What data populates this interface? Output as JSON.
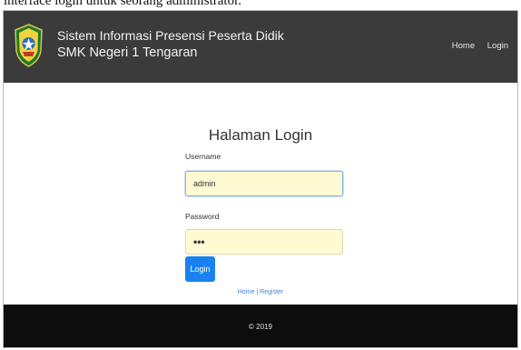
{
  "caption": "interface login untuk seorang administrator.",
  "header": {
    "brand_line1": "Sistem Informasi Presensi Peserta Didik",
    "brand_line2": "SMK Negeri 1 Tengaran",
    "nav_home": "Home",
    "nav_login": "Login",
    "logo_icon": "school-emblem-icon"
  },
  "form": {
    "title": "Halaman Login",
    "username_label": "Username",
    "username_value": "admin",
    "password_label": "Password",
    "password_value": "•••",
    "login_button": "Login",
    "link_home": "Home",
    "link_separator": "|",
    "link_register": "Register"
  },
  "footer": {
    "copyright": "© 2019"
  },
  "colors": {
    "navbar": "#3b3b3b",
    "footer": "#0d0d0d",
    "button": "#1a82f0",
    "input_bg": "#fefbd2",
    "link": "#3b7fd4"
  }
}
